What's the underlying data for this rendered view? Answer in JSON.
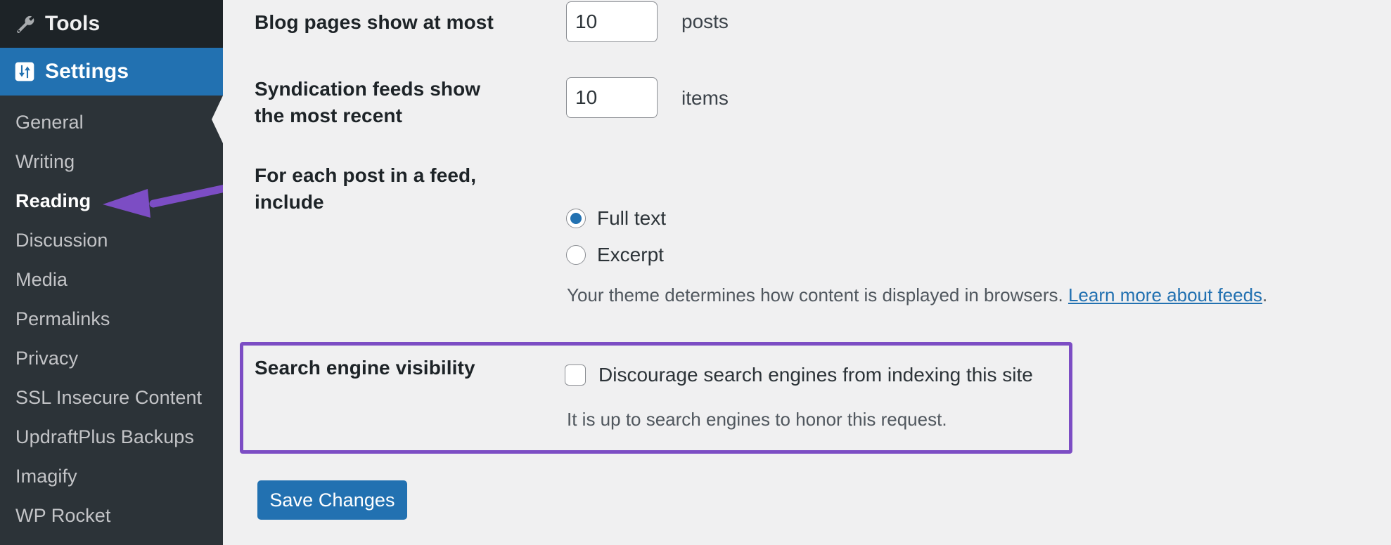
{
  "sidebar": {
    "top_item": {
      "label": "Tools",
      "icon": "wrench-icon"
    },
    "current_item": {
      "label": "Settings",
      "icon": "sliders-icon"
    },
    "submenu": [
      {
        "label": "General",
        "current": false
      },
      {
        "label": "Writing",
        "current": false
      },
      {
        "label": "Reading",
        "current": true
      },
      {
        "label": "Discussion",
        "current": false
      },
      {
        "label": "Media",
        "current": false
      },
      {
        "label": "Permalinks",
        "current": false
      },
      {
        "label": "Privacy",
        "current": false
      },
      {
        "label": "SSL Insecure Content",
        "current": false
      },
      {
        "label": "UpdraftPlus Backups",
        "current": false
      },
      {
        "label": "Imagify",
        "current": false
      },
      {
        "label": "WP Rocket",
        "current": false
      }
    ]
  },
  "settings": {
    "blog_pages": {
      "label": "Blog pages show at most",
      "value": "10",
      "unit": "posts"
    },
    "syndication": {
      "label": "Syndication feeds show the most recent",
      "value": "10",
      "unit": "items"
    },
    "feed_content": {
      "label": "For each post in a feed, include",
      "options": [
        {
          "label": "Full text",
          "selected": true
        },
        {
          "label": "Excerpt",
          "selected": false
        }
      ],
      "help_prefix": "Your theme determines how content is displayed in browsers. ",
      "help_link": "Learn more about feeds",
      "help_suffix": "."
    },
    "search_visibility": {
      "label": "Search engine visibility",
      "checkbox_label": "Discourage search engines from indexing this site",
      "checked": false,
      "help": "It is up to search engines to honor this request."
    },
    "save_label": "Save Changes"
  },
  "annotation": {
    "type": "arrow",
    "color": "#7c4dc4",
    "points_to": "Reading"
  },
  "colors": {
    "sidebar_bg": "#2c3338",
    "sidebar_top_bg": "#1d2327",
    "accent_blue": "#2271b1",
    "highlight_purple": "#7c4dc4",
    "page_bg": "#f0f0f1"
  }
}
